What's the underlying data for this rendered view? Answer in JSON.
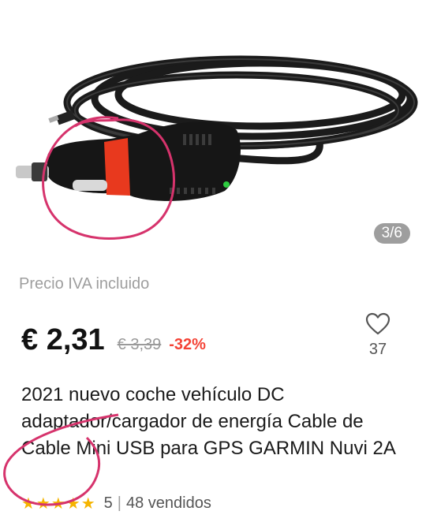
{
  "product": {
    "image_counter": "3/6",
    "tax_note": "Precio IVA incluido",
    "price": "€ 2,31",
    "original_price": "€ 3,39",
    "discount": "-32%",
    "favorites_count": "37",
    "title": "2021 nuevo coche vehículo DC adaptador/cargador de energía Cable de Cable Mini USB para GPS GARMIN Nuvi 2A",
    "stars": "★★★★★",
    "rating": "5",
    "separator": "|",
    "sold": "48 vendidos"
  },
  "colors": {
    "price": "#111111",
    "discount": "#f44336",
    "star": "#f5b400",
    "annotation": "#d6336c"
  }
}
